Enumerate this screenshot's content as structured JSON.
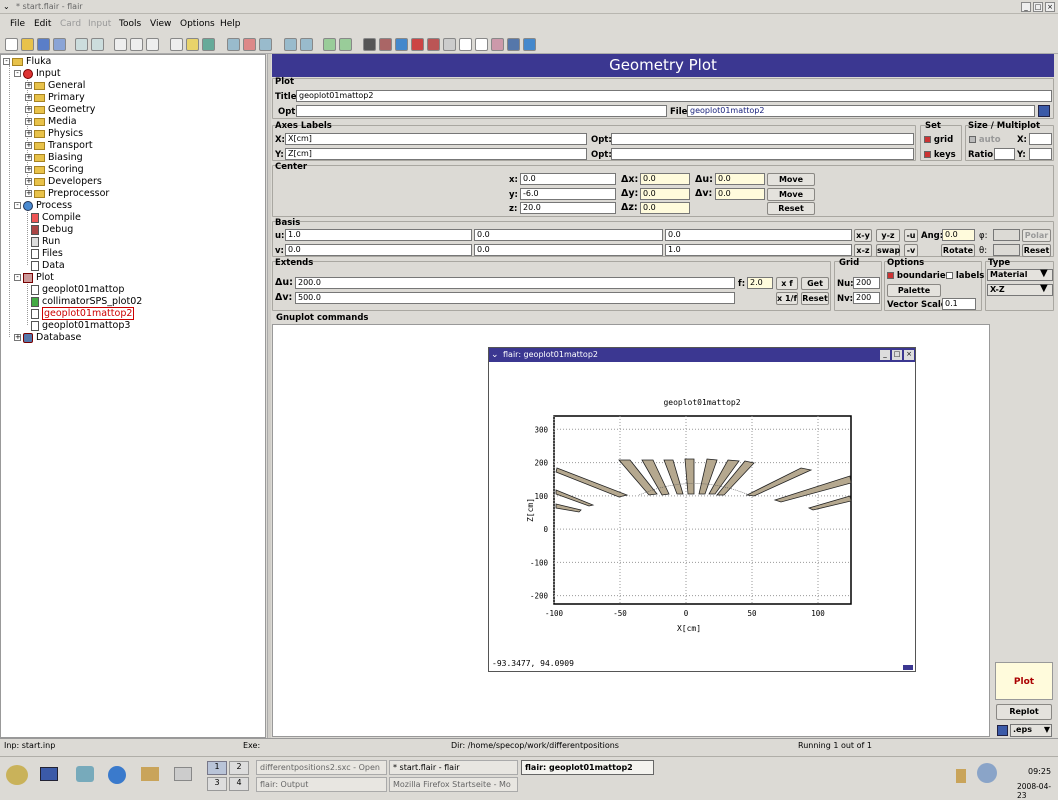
{
  "window": {
    "title": "* start.flair - flair"
  },
  "menu": [
    "File",
    "Edit",
    "Card",
    "Input",
    "Tools",
    "View",
    "Options",
    "Help"
  ],
  "tree": {
    "root": "Fluka",
    "input": "Input",
    "input_items": [
      "General",
      "Primary",
      "Geometry",
      "Media",
      "Physics",
      "Transport",
      "Biasing",
      "Scoring",
      "Developers",
      "Preprocessor"
    ],
    "process": "Process",
    "process_items": [
      "Compile",
      "Debug",
      "Run",
      "Files",
      "Data"
    ],
    "plot": "Plot",
    "plot_items": [
      "geoplot01mattop",
      "collimatorSPS_plot02",
      "geoplot01mattop2",
      "geoplot01mattop3"
    ],
    "database": "Database"
  },
  "header": "Geometry Plot",
  "plot": {
    "section": "Plot",
    "title_label": "Title:",
    "title_value": "geoplot01mattop2",
    "opt_label": "Opt:",
    "file_label": "File:",
    "file_value": "geoplot01mattop2"
  },
  "axes": {
    "section": "Axes Labels",
    "x_label": "X:",
    "x_value": "X[cm]",
    "y_label": "Y:",
    "y_value": "Z[cm]",
    "opt1": "Opt:",
    "opt2": "Opt:"
  },
  "set": {
    "section": "Set",
    "grid": "grid",
    "keys": "keys"
  },
  "size": {
    "section": "Size / Multiplot",
    "auto": "auto",
    "ratio": "Ratio:",
    "x": "X:",
    "y": "Y:"
  },
  "center": {
    "section": "Center",
    "x": "x:",
    "x_val": "0.0",
    "y": "y:",
    "y_val": "-6.0",
    "z": "z:",
    "z_val": "20.0",
    "dx": "Δx:",
    "dx_val": "0.0",
    "dy": "Δy:",
    "dy_val": "0.0",
    "dz": "Δz:",
    "dz_val": "0.0",
    "du": "Δu:",
    "du_val": "0.0",
    "dv": "Δv:",
    "dv_val": "0.0",
    "move": "Move",
    "move_uv": "Move [u,v]",
    "reset": "Reset"
  },
  "basis": {
    "section": "Basis",
    "u": "u:",
    "u_vals": [
      "1.0",
      "0.0",
      "0.0"
    ],
    "v": "v:",
    "v_vals": [
      "0.0",
      "0.0",
      "1.0"
    ],
    "xy": "x-y",
    "yz": "y-z",
    "mu": "-u",
    "xz": "x-z",
    "swap": "swap",
    "mv": "-v",
    "ang": "Ang:",
    "ang_val": "0.0",
    "phi": "φ:",
    "theta": "θ:",
    "polar": "Polar",
    "rotate": "Rotate",
    "reset": "Reset"
  },
  "extends": {
    "section": "Extends",
    "du": "Δu:",
    "du_val": "200.0",
    "dv": "Δv:",
    "dv_val": "500.0",
    "f": "f:",
    "f_val": "2.0",
    "xf": "x f",
    "get": "Get",
    "x1f": "x 1/f",
    "reset": "Reset"
  },
  "grid": {
    "section": "Grid",
    "nu": "Nu:",
    "nu_val": "200",
    "nv": "Nv:",
    "nv_val": "200"
  },
  "options": {
    "section": "Options",
    "boundaries": "boundaries",
    "labels": "labels",
    "palette": "Palette",
    "vscale": "Vector Scale:",
    "vscale_val": "0.1"
  },
  "type": {
    "section": "Type",
    "material": "Material",
    "proj": "X-Z"
  },
  "gnuplot": {
    "section": "Gnuplot commands"
  },
  "side": {
    "plot": "Plot",
    "replot": "Replot",
    "format": ".eps"
  },
  "plotwin": {
    "title": "flair: geoplot01mattop2",
    "readout": "-93.3477,  94.0909"
  },
  "chart_data": {
    "type": "scatter",
    "title": "geoplot01mattop2",
    "xlabel": "X[cm]",
    "ylabel": "Z[cm]",
    "xlim": [
      -100,
      125
    ],
    "ylim": [
      -225,
      340
    ],
    "xticks": [
      "-100",
      "-50",
      "0",
      "50",
      "100"
    ],
    "yticks": [
      "300",
      "200",
      "100",
      "0",
      "-100",
      "-200"
    ],
    "grid": true
  },
  "status": {
    "inp": "Inp: start.inp",
    "exe": "Exe:",
    "dir": "Dir: /home/specop/work/differentpositions",
    "running": "Running 1 out of 1"
  },
  "taskbar": {
    "desk": [
      "1",
      "2",
      "3",
      "4"
    ],
    "tasks": [
      "differentpositions2.sxc - Open",
      "* start.flair - flair",
      "flair: geoplot01mattop2",
      "flair: Output",
      "Mozilla Firefox Startseite - Mo"
    ],
    "time": "09:25",
    "date": "2008-04-23"
  }
}
